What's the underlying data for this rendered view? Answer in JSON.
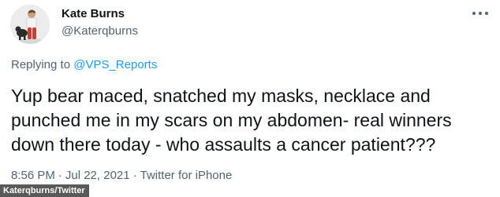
{
  "author": {
    "display_name": "Kate Burns",
    "handle": "@Katerqburns",
    "avatar_icon": "person-with-dog-avatar"
  },
  "menu": {
    "icon": "more-horizontal-icon"
  },
  "reply": {
    "prefix": "Replying to ",
    "target": "@VPS_Reports"
  },
  "tweet": {
    "text": "Yup bear maced, snatched my masks, necklace and\npunched me in my scars on my abdomen- real winners\ndown there today - who assaults a cancer patient???"
  },
  "meta": {
    "time": "8:56 PM",
    "date": "Jul 22, 2021",
    "separator": "·",
    "source": "Twitter for iPhone"
  },
  "watermark": {
    "text": "Katerqburns/Twitter"
  },
  "colors": {
    "link": "#1d9bf0",
    "secondary_text": "#536471",
    "primary_text": "#0f1419"
  }
}
